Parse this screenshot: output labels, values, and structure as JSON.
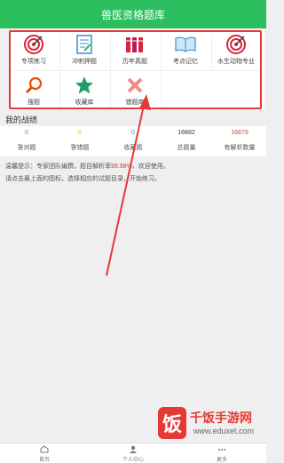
{
  "header": {
    "title": "兽医资格题库"
  },
  "menu": [
    {
      "label": "专项练习",
      "icon": "target-icon"
    },
    {
      "label": "冲刺押题",
      "icon": "document-edit-icon"
    },
    {
      "label": "历年真题",
      "icon": "books-icon"
    },
    {
      "label": "考点记忆",
      "icon": "open-book-icon"
    },
    {
      "label": "水生动物专业",
      "icon": "target-icon"
    },
    {
      "label": "搜题",
      "icon": "search-icon"
    },
    {
      "label": "收藏库",
      "icon": "star-icon"
    },
    {
      "label": "错题库",
      "icon": "cross-icon"
    }
  ],
  "record": {
    "title": "我的战绩",
    "stats": [
      {
        "value": "0",
        "label": "答对题",
        "color": "#2a9fd6"
      },
      {
        "value": "0",
        "label": "答错题",
        "color": "#c8c800"
      },
      {
        "value": "0",
        "label": "收藏题",
        "color": "#2a9fd6"
      },
      {
        "value": "16882",
        "label": "总题量",
        "color": "#333333"
      },
      {
        "value": "16879",
        "label": "有解析数量",
        "color": "#e53935"
      }
    ]
  },
  "tip": {
    "line1_a": "温馨提示：专家团队编撰，题目解析率",
    "line1_rate": "99.98%",
    "line1_b": "，欢迎使用。",
    "line2": "请点击最上面的图标，选择相应的试题目录，开始练习。"
  },
  "tabs": [
    {
      "label": "首页",
      "icon": "home-icon"
    },
    {
      "label": "个人中心",
      "icon": "user-icon"
    },
    {
      "label": "更多",
      "icon": "more-icon"
    }
  ],
  "watermark": {
    "text": "千饭手游网",
    "url": "www.eduxet.com",
    "logo_char": "饭"
  },
  "colors": {
    "brand": "#2dbe60",
    "highlight": "#e53935"
  }
}
